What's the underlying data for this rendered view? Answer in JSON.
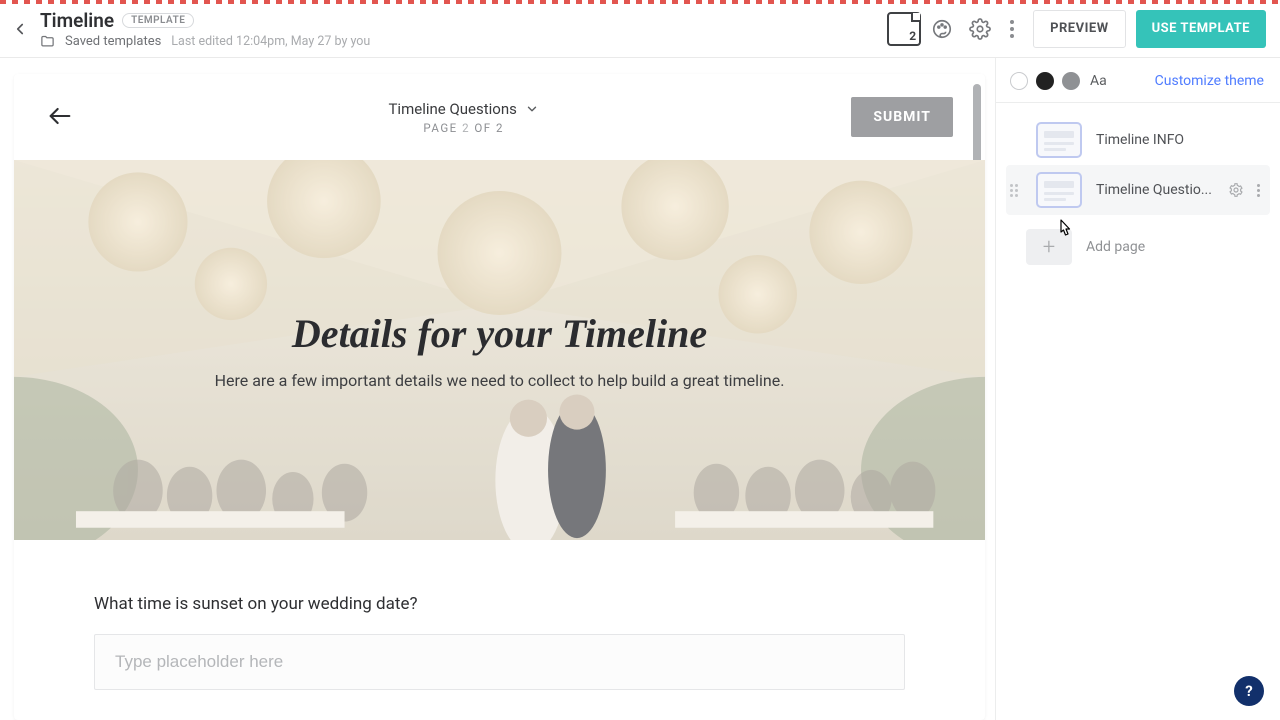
{
  "header": {
    "title": "Timeline",
    "chip": "TEMPLATE",
    "saved_location": "Saved templates",
    "last_edited": "Last edited 12:04pm, May 27 by you",
    "page_count": "2",
    "preview_label": "PREVIEW",
    "use_label": "USE TEMPLATE"
  },
  "canvas": {
    "section_title": "Timeline Questions",
    "page_prefix": "PAGE ",
    "page_current": "2",
    "page_suffix": " OF 2",
    "submit_label": "SUBMIT",
    "hero_title": "Details for your Timeline",
    "hero_sub": "Here are a few important details we need to collect to help build a great timeline.",
    "question1_label": "What time is sunset on your wedding date?",
    "question1_placeholder": "Type placeholder here"
  },
  "sidebar": {
    "aa": "Aa",
    "customize": "Customize theme",
    "pages": [
      {
        "label": "Timeline INFO"
      },
      {
        "label": "Timeline Questio..."
      }
    ],
    "add_page": "Add page"
  },
  "help": {
    "label": "?"
  },
  "colors": {
    "accent": "#35c3b9",
    "link": "#4f7cff",
    "help_bg": "#12306b"
  }
}
